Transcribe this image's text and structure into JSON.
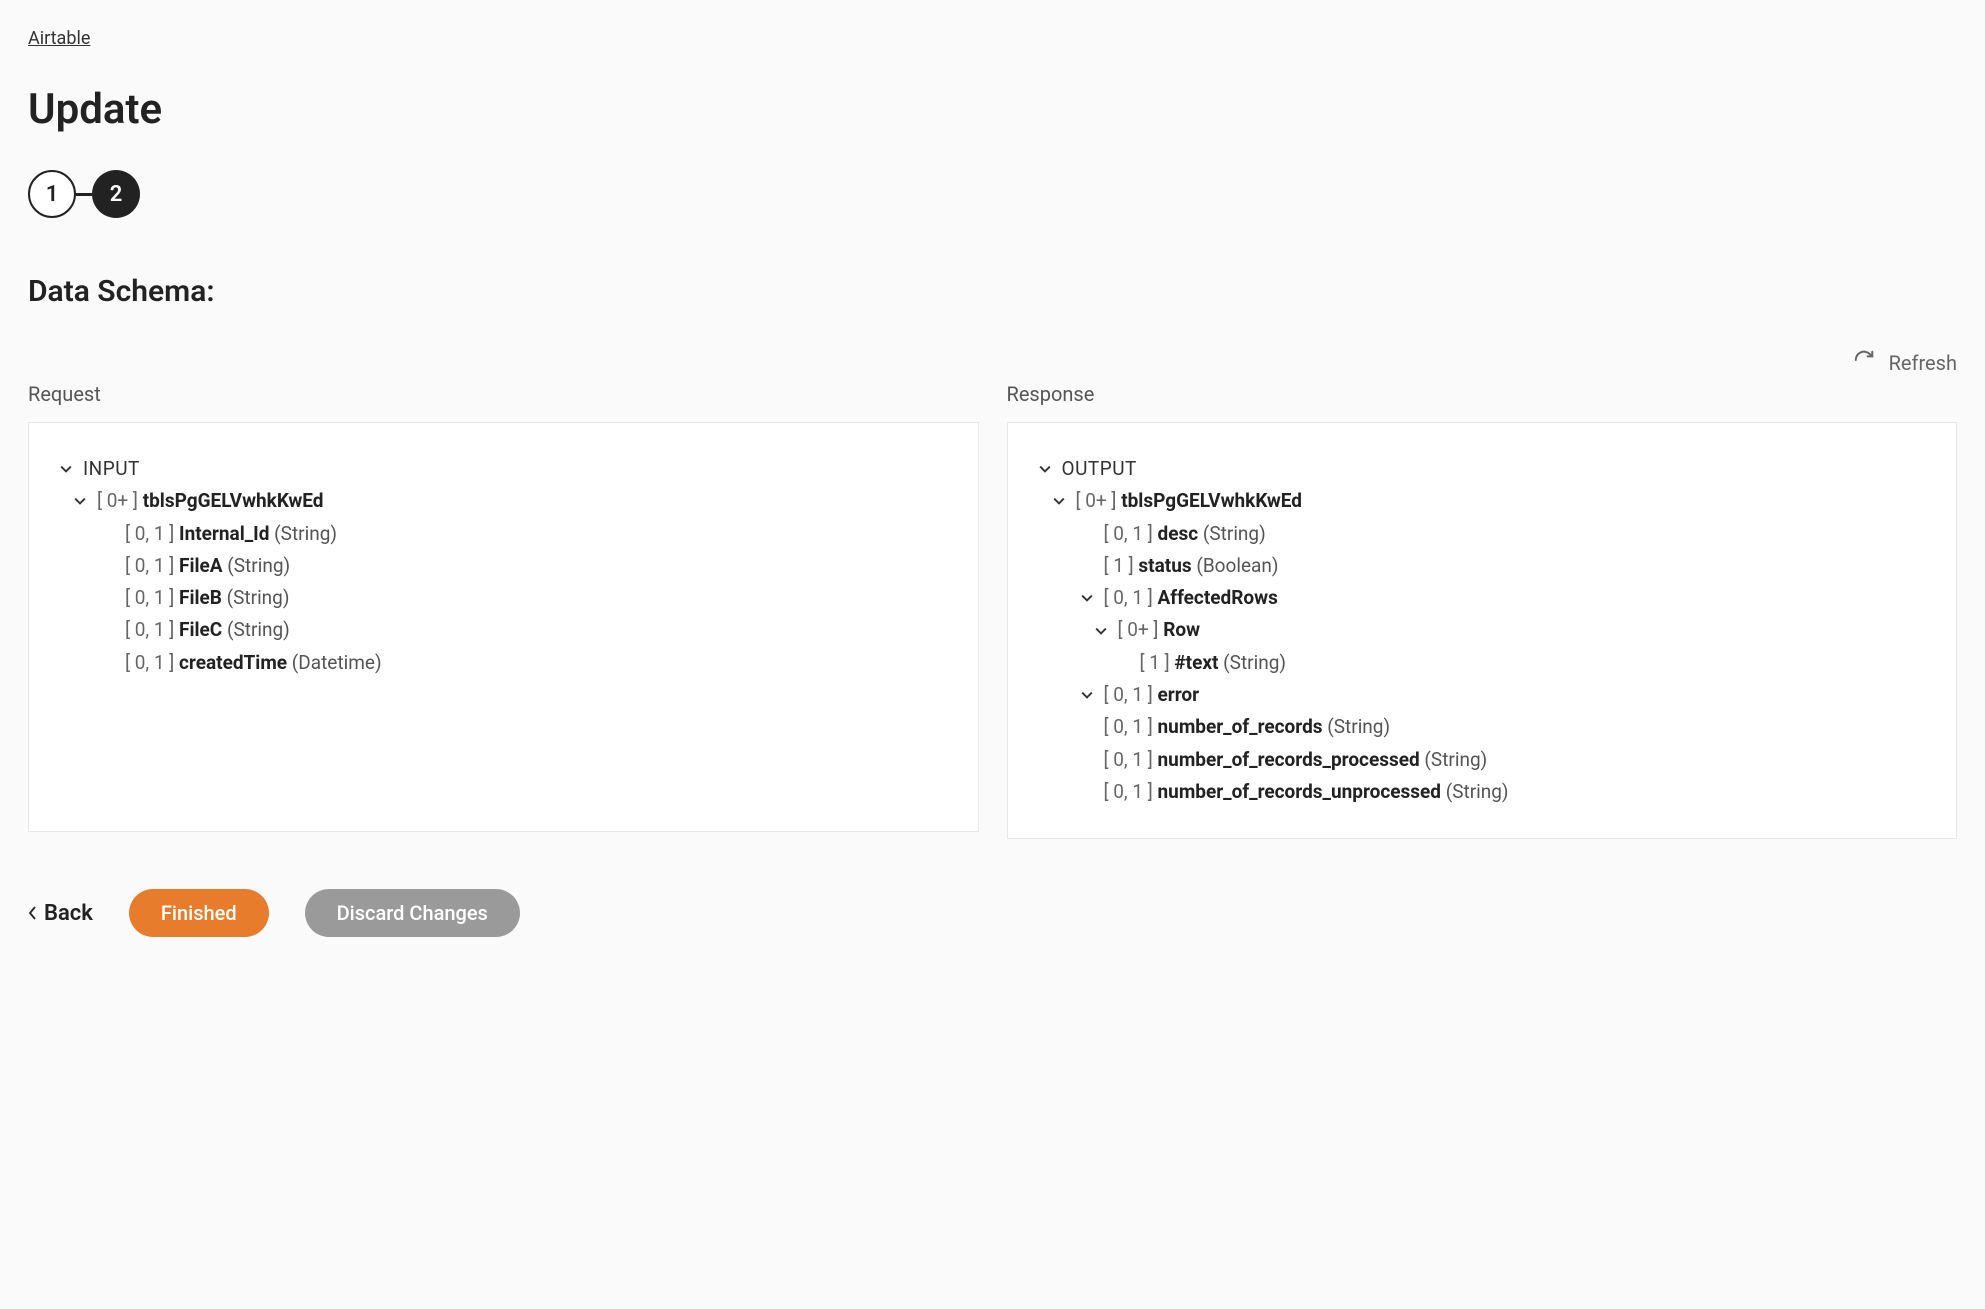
{
  "breadcrumb": "Airtable",
  "title": "Update",
  "stepper": {
    "step1": "1",
    "step2": "2"
  },
  "section_heading": "Data Schema:",
  "refresh_label": "Refresh",
  "request_label": "Request",
  "response_label": "Response",
  "input_root": "INPUT",
  "output_root": "OUTPUT",
  "request_tree": {
    "table": {
      "card": "[ 0+ ]",
      "name": "tblsPgGELVwhkKwEd"
    },
    "fields": [
      {
        "card": "[ 0, 1 ]",
        "name": "Internal_Id",
        "type": "(String)"
      },
      {
        "card": "[ 0, 1 ]",
        "name": "FileA",
        "type": "(String)"
      },
      {
        "card": "[ 0, 1 ]",
        "name": "FileB",
        "type": "(String)"
      },
      {
        "card": "[ 0, 1 ]",
        "name": "FileC",
        "type": "(String)"
      },
      {
        "card": "[ 0, 1 ]",
        "name": "createdTime",
        "type": "(Datetime)"
      }
    ]
  },
  "response_tree": {
    "table": {
      "card": "[ 0+ ]",
      "name": "tblsPgGELVwhkKwEd"
    },
    "table_fields": [
      {
        "card": "[ 0, 1 ]",
        "name": "desc",
        "type": "(String)"
      },
      {
        "card": "[ 1 ]",
        "name": "status",
        "type": "(Boolean)"
      }
    ],
    "affected": {
      "card": "[ 0, 1 ]",
      "name": "AffectedRows"
    },
    "row": {
      "card": "[ 0+ ]",
      "name": "Row"
    },
    "row_fields": [
      {
        "card": "[ 1 ]",
        "name": "#text",
        "type": "(String)"
      }
    ],
    "error": {
      "card": "[ 0, 1 ]",
      "name": "error"
    },
    "error_fields": [
      {
        "card": "[ 0, 1 ]",
        "name": "number_of_records",
        "type": "(String)"
      },
      {
        "card": "[ 0, 1 ]",
        "name": "number_of_records_processed",
        "type": "(String)"
      },
      {
        "card": "[ 0, 1 ]",
        "name": "number_of_records_unprocessed",
        "type": "(String)"
      }
    ]
  },
  "footer": {
    "back": "Back",
    "finished": "Finished",
    "discard": "Discard Changes"
  }
}
